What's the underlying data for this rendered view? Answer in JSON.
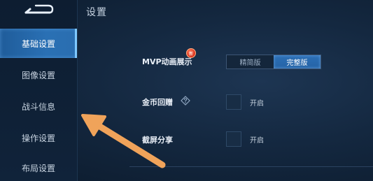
{
  "header": {
    "title": "设置"
  },
  "sidebar": {
    "items": [
      {
        "label": "基础设置",
        "active": true
      },
      {
        "label": "图像设置",
        "active": false
      },
      {
        "label": "战斗信息",
        "active": false
      },
      {
        "label": "操作设置",
        "active": false
      },
      {
        "label": "布局设置",
        "active": false
      }
    ]
  },
  "settings": {
    "mvp": {
      "label": "MVP动画展示",
      "badge": "新",
      "options": [
        "精简版",
        "完整版"
      ],
      "selected": "完整版"
    },
    "coin": {
      "label": "金币回赠",
      "help_icon": "question-diamond-icon",
      "toggle_label": "开启",
      "checked": false
    },
    "screenshot": {
      "label": "截屏分享",
      "toggle_label": "开启",
      "checked": false
    }
  },
  "annotation": {
    "arrow_color": "#f0a35a"
  },
  "colors": {
    "accent": "#2a6eb0",
    "background": "#142840",
    "badge": "#d8321e"
  }
}
